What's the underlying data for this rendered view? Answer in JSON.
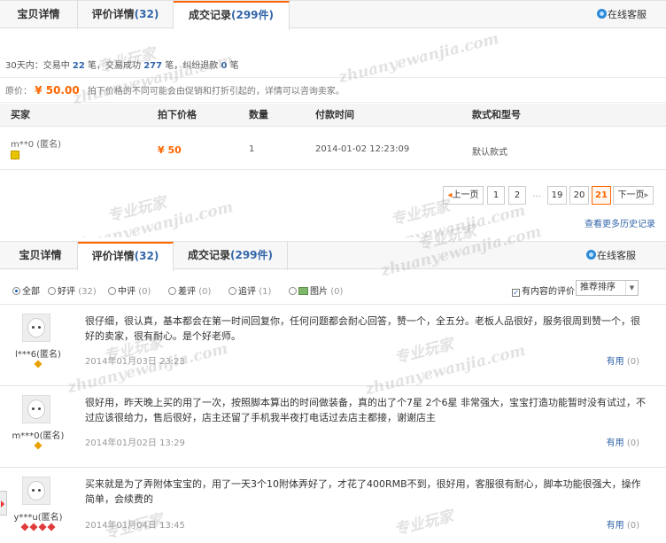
{
  "deal_panel": {
    "tabs": [
      {
        "label": "宝贝详情",
        "count": ""
      },
      {
        "label": "评价详情",
        "count": "(32)"
      },
      {
        "label": "成交记录",
        "count": "(299件)"
      }
    ],
    "service_label": "在线客服",
    "stats": {
      "prefix": "30天内：交易中",
      "in_progress": "22",
      "unit1": "笔，交易成功",
      "success": "277",
      "unit2": "笔，纠纷退款",
      "refund": "0",
      "unit3": "笔"
    },
    "original_price": {
      "label": "原价：",
      "value": "¥ 50.00",
      "note": "拍下价格的不同可能会由促销和打折引起的，详情可以咨询卖家。"
    },
    "columns": [
      "买家",
      "拍下价格",
      "数量",
      "付款时间",
      "款式和型号"
    ],
    "row": {
      "buyer": "m**0 (匿名)",
      "price": "¥ 50",
      "qty": "1",
      "paid_time": "2014-01-02 12:23:09",
      "style": "默认款式"
    },
    "pagination": {
      "prev": "上一页",
      "pages": [
        "1",
        "2",
        "...",
        "19",
        "20",
        "21"
      ],
      "current": "21",
      "next": "下一页"
    },
    "more_history": "查看更多历史记录"
  },
  "review_panel": {
    "tabs": [
      {
        "label": "宝贝详情",
        "count": ""
      },
      {
        "label": "评价详情",
        "count": "(32)"
      },
      {
        "label": "成交记录",
        "count": "(299件)"
      }
    ],
    "service_label": "在线客服",
    "filters": [
      {
        "label": "全部",
        "count": "",
        "selected": true
      },
      {
        "label": "好评",
        "count": "(32)",
        "selected": false
      },
      {
        "label": "中评",
        "count": "(0)",
        "selected": false
      },
      {
        "label": "差评",
        "count": "(0)",
        "selected": false
      },
      {
        "label": "追评",
        "count": "(1)",
        "selected": false
      },
      {
        "label": "图片",
        "count": "(0)",
        "selected": false
      }
    ],
    "has_content_label": "有内容的评价",
    "sort_label": "推荐排序",
    "reviews": [
      {
        "user": "l***6(匿名)",
        "text": "很仔细，很认真，基本都会在第一时间回复你，任何问题都会耐心回答，赞一个，全五分。老板人品很好，服务很周到赞一个，很好的卖家，很有耐心。是个好老师。",
        "date": "2014年01月03日 23:23",
        "useful": "有用",
        "useful_count": "(0)"
      },
      {
        "user": "m***0(匿名)",
        "text": "很好用，昨天晚上买的用了一次，按照脚本算出的时间做装备，真的出了个7星 2个6星 非常强大，宝宝打造功能暂时没有试过，不过应该很给力，售后很好，店主还留了手机我半夜打电话过去店主都接，谢谢店主",
        "date": "2014年01月02日 13:29",
        "useful": "有用",
        "useful_count": "(0)"
      },
      {
        "user": "y***u(匿名)",
        "text": "买来就是为了弄附体宝宝的，用了一天3个10附体弄好了，才花了400RMB不到，很好用，客服很有耐心，脚本功能很强大，操作简单，会续费的",
        "date": "2014年01月04日 13:45",
        "useful": "有用",
        "useful_count": "(0)"
      }
    ]
  },
  "watermark": {
    "cn": "专业玩家",
    "en": "zhuanyewanjia.com"
  },
  "colors": {
    "accent": "#ff6600",
    "link": "#3366aa"
  }
}
